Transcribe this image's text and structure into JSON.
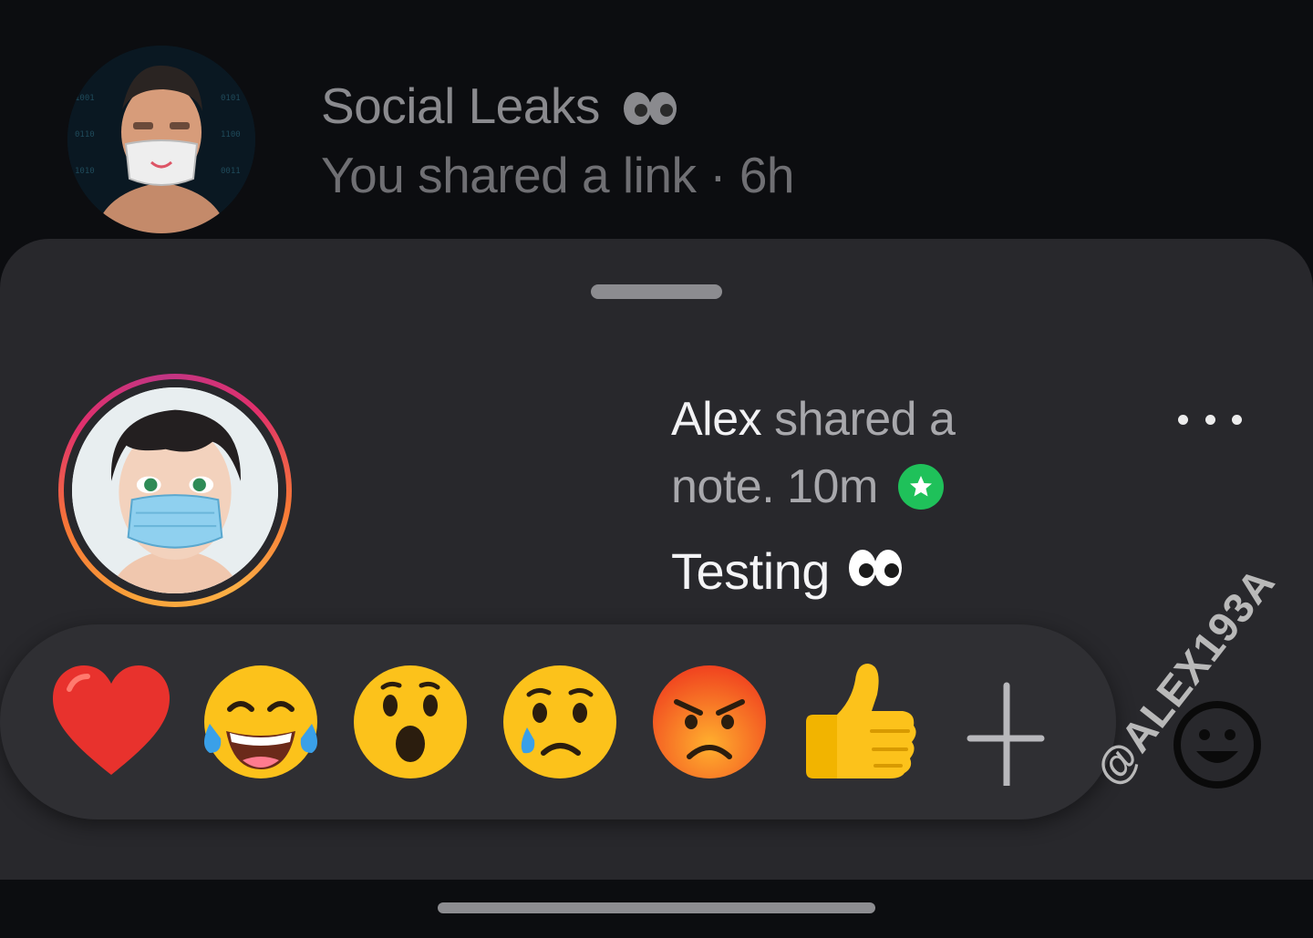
{
  "background_post": {
    "title": "Social Leaks",
    "title_emoji": "eyes-icon",
    "subtitle": "You shared a link · 6h"
  },
  "note": {
    "author": "Alex",
    "action": " shared a",
    "action_cont": "note. 10m",
    "status_badge": "green-star-badge",
    "text": "Testing",
    "text_emoji": "eyes-icon"
  },
  "reactions": [
    {
      "name": "heart-emoji"
    },
    {
      "name": "tears-of-joy-emoji"
    },
    {
      "name": "surprised-emoji"
    },
    {
      "name": "sad-emoji"
    },
    {
      "name": "angry-emoji"
    },
    {
      "name": "thumbs-up-emoji"
    },
    {
      "name": "add-reaction-icon"
    }
  ],
  "watermark": "@ALEX193A",
  "colors": {
    "sheet_bg": "#28282c",
    "reaction_bar_bg": "#2f2f33",
    "badge_green": "#1fc15a",
    "background": "#0c0d10"
  }
}
